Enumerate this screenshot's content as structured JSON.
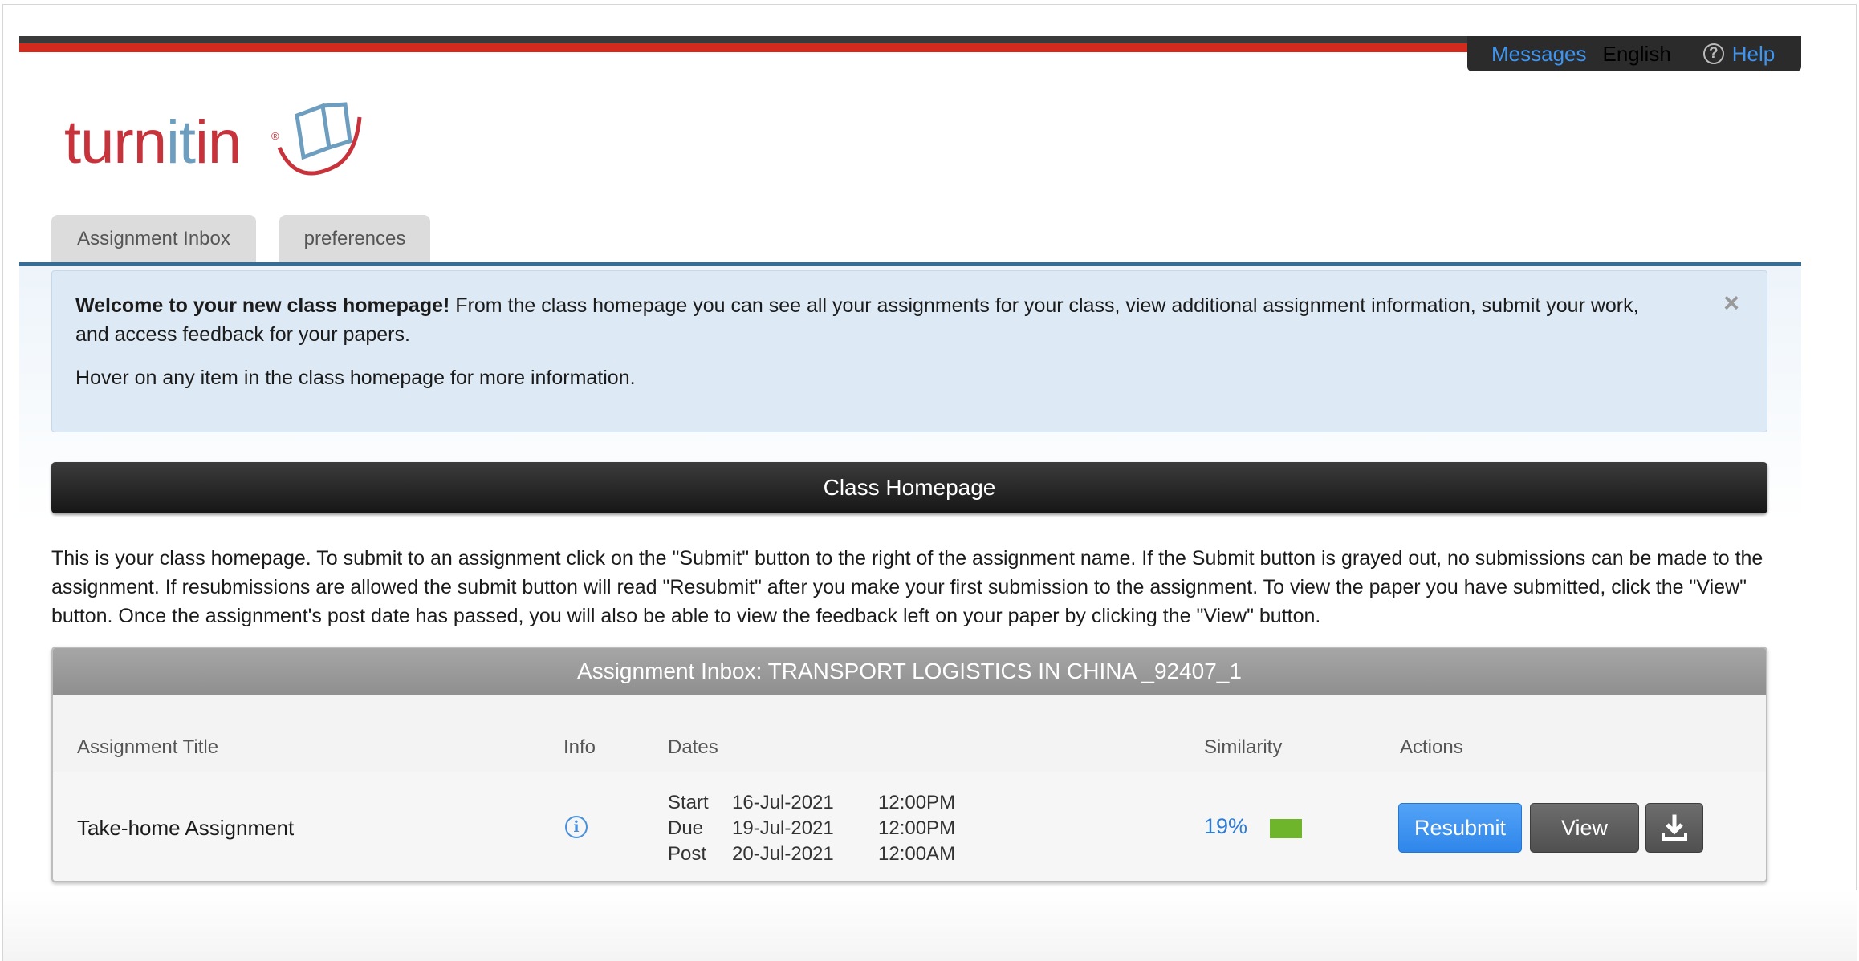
{
  "topnav": {
    "messages": "Messages",
    "language": "English",
    "help_icon": "question-circle-icon",
    "help": "Help"
  },
  "logo": {
    "text_a": "turn",
    "text_b": "it",
    "text_c": "in",
    "reg": "®"
  },
  "tabs": [
    {
      "label": "Assignment Inbox"
    },
    {
      "label": "preferences"
    }
  ],
  "welcome": {
    "bold": "Welcome to your new class homepage!",
    "text": " From the class homepage you can see all your assignments for your class, view additional assignment information, submit your work, and access feedback for your papers.",
    "hover": "Hover on any item in the class homepage for more information.",
    "close_icon": "×"
  },
  "class_bar": {
    "title": "Class Homepage"
  },
  "instructions": "This is your class homepage. To submit to an assignment click on the \"Submit\" button to the right of the assignment name. If the Submit button is grayed out, no submissions can be made to the assignment. If resubmissions are allowed the submit button will read \"Resubmit\" after you make your first submission to the assignment. To view the paper you have submitted, click the \"View\" button. Once the assignment's post date has passed, you will also be able to view the feedback left on your paper by clicking the \"View\" button.",
  "inbox": {
    "header": "Assignment Inbox: TRANSPORT LOGISTICS IN CHINA _92407_1",
    "columns": {
      "title": "Assignment Title",
      "info": "Info",
      "dates": "Dates",
      "similarity": "Similarity",
      "actions": "Actions"
    },
    "rows": [
      {
        "title": "Take-home Assignment",
        "info_icon": "i",
        "dates": [
          {
            "label": "Start",
            "date": "16-Jul-2021",
            "time": "12:00PM"
          },
          {
            "label": "Due",
            "date": "19-Jul-2021",
            "time": "12:00PM"
          },
          {
            "label": "Post",
            "date": "20-Jul-2021",
            "time": "12:00AM"
          }
        ],
        "similarity": "19%",
        "similarity_color": "#6fb52c",
        "resubmit": "Resubmit",
        "view": "View",
        "download_icon": "download-icon"
      }
    ]
  },
  "colors": {
    "accent_blue": "#3f95ee",
    "brand_red": "#c8323a",
    "resubmit_blue": "#2f86ea"
  }
}
